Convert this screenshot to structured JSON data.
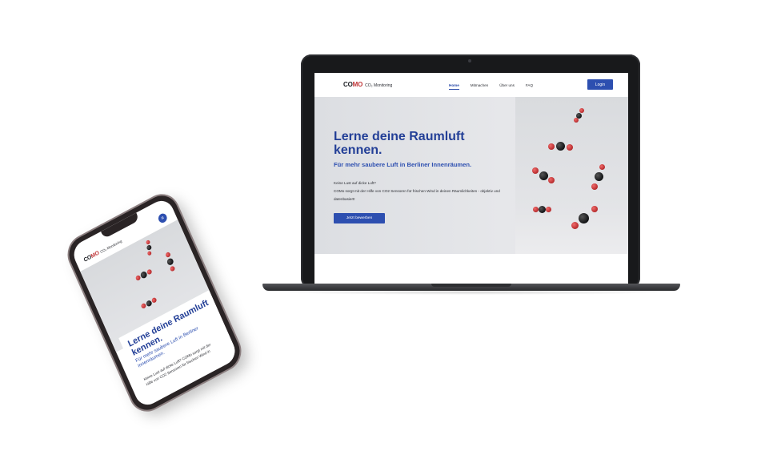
{
  "site": {
    "brand": "CO",
    "brand_mark": "MO",
    "brand_sub": "CO₂ Monitoring",
    "nav": [
      "Home",
      "Mitmachen",
      "Über uns",
      "FAQ"
    ],
    "login": "Login"
  },
  "hero": {
    "title": "Lerne deine Raumluft kennen.",
    "subtitle": "Für mehr saubere Luft in Berliner Innenräumen.",
    "line1": "Keine Lust auf dicke Luft?",
    "line2": "COMo sorgt mit der Hilfe von CO2 Sensoren für frischen Wind in deinen Räumlichkeiten - objektiv und datenbasiert!",
    "cta": "Jetzt bewerben"
  },
  "phone": {
    "title": "Lerne deine Raumluft kennen.",
    "subtitle": "Für mehr saubere Luft in Berliner Innenräumen.",
    "text": "Keine Lust auf dicke Luft? COMo sorgt mit der Hilfe von CO2 Sensoren für frischen Wind in",
    "menu_icon": "menu-icon"
  },
  "colors": {
    "brand_blue": "#2d4fb0",
    "title_blue": "#233f97",
    "accent_red": "#c0383a"
  }
}
